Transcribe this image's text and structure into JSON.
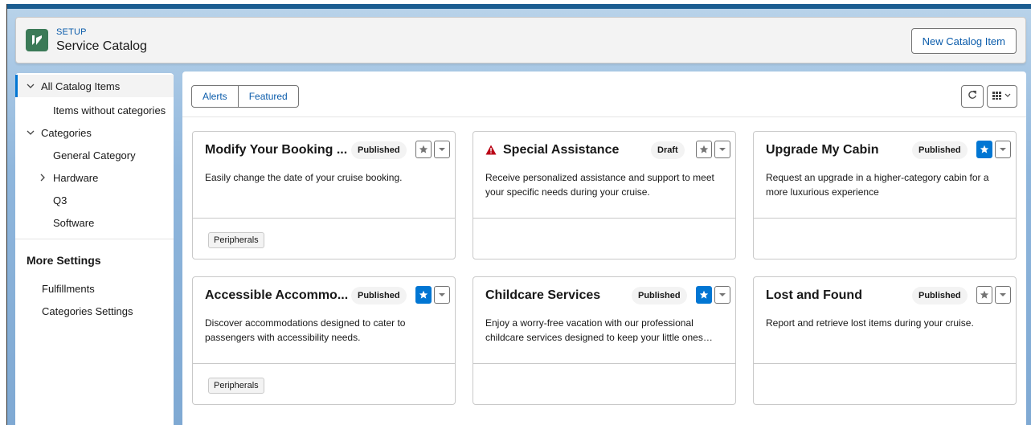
{
  "header": {
    "setup_label": "SETUP",
    "title": "Service Catalog",
    "new_button": "New Catalog Item"
  },
  "sidebar": {
    "items": [
      {
        "label": "All Catalog Items",
        "expanded": true,
        "active": true
      },
      {
        "label": "Items without categories"
      },
      {
        "label": "Categories",
        "expanded": true
      },
      {
        "label": "General Category"
      },
      {
        "label": "Hardware",
        "expanded": false
      },
      {
        "label": "Q3"
      },
      {
        "label": "Software"
      }
    ],
    "more_settings_heading": "More Settings",
    "settings": [
      {
        "label": "Fulfillments"
      },
      {
        "label": "Categories Settings"
      }
    ]
  },
  "toolbar": {
    "filters": [
      "Alerts",
      "Featured"
    ],
    "refresh_icon": "refresh-icon",
    "view_icon": "grid-view-icon"
  },
  "cards": [
    {
      "title": "Modify Your Booking ...",
      "status": "Published",
      "favorited": false,
      "description": "Easily change the date of your cruise booking.",
      "tag": "Peripherals",
      "warning": false
    },
    {
      "title": "Special Assistance",
      "status": "Draft",
      "favorited": false,
      "description": "Receive personalized assistance and support to meet your specific needs during your cruise.",
      "tag": "",
      "warning": true
    },
    {
      "title": "Upgrade My Cabin",
      "status": "Published",
      "favorited": true,
      "description": "Request an upgrade in a higher-category cabin for a more luxurious experience",
      "tag": "",
      "warning": false
    },
    {
      "title": "Accessible Accommo...",
      "status": "Published",
      "favorited": true,
      "description": "Discover accommodations designed to cater to passengers with accessibility needs.",
      "tag": "Peripherals",
      "warning": false
    },
    {
      "title": "Childcare Services",
      "status": "Published",
      "favorited": true,
      "description": "Enjoy a worry-free vacation with our professional childcare services designed to keep your little ones…",
      "tag": "",
      "warning": false
    },
    {
      "title": "Lost and Found",
      "status": "Published",
      "favorited": false,
      "description": "Report and retrieve lost items during your cruise.",
      "tag": "",
      "warning": false
    }
  ],
  "colors": {
    "brand_blue": "#0176d3",
    "link_blue": "#0b5cab",
    "app_icon_green": "#3b7a57",
    "warning_red": "#ba0517"
  }
}
